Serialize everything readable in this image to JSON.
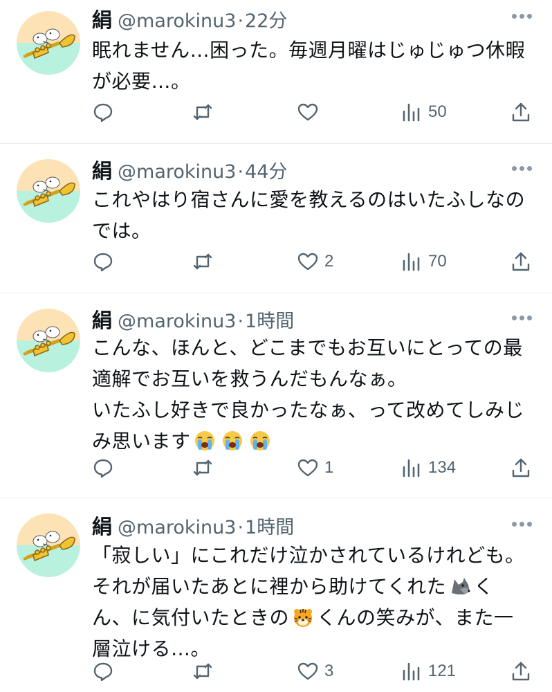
{
  "icons": {
    "reply": "reply-bubble-icon",
    "retweet": "retweet-icon",
    "like": "heart-icon",
    "views": "views-bar-icon",
    "share": "share-upload-icon",
    "more": "more-dots-icon"
  },
  "colors": {
    "text": "#0f1419",
    "muted": "#536471",
    "divider": "#e6e9ec"
  },
  "tweets": [
    {
      "name": "絹",
      "handle": "@marokinu3",
      "dot": "·",
      "time": "22分",
      "lines": [
        "眠れません…困った。毎週月曜はじゅじゅつ休暇",
        "が必要…。"
      ],
      "likes": "",
      "views": "50"
    },
    {
      "name": "絹",
      "handle": "@marokinu3",
      "dot": "·",
      "time": "44分",
      "lines": [
        "これやはり宿さんに愛を教えるのはいたふしなの",
        "では。"
      ],
      "likes": "2",
      "views": "70"
    },
    {
      "name": "絹",
      "handle": "@marokinu3",
      "dot": "·",
      "time": "1時間",
      "lines": [
        "こんな、ほんと、どこまでもお互いにとっての最",
        "適解でお互いを救うんだもんなぁ。",
        "いたふし好きで良かったなぁ、って改めてしみじ",
        "み思います"
      ],
      "emoji_crying": "😭😭😭",
      "likes": "1",
      "views": "134"
    },
    {
      "name": "絹",
      "handle": "@marokinu3",
      "dot": "·",
      "time": "1時間",
      "lines": [
        "「寂しい」にこれだけ泣かされているけれども。",
        "それが届いたあとに裡から助けてくれた",
        "ん、に気付いたときの",
        "層泣ける…。"
      ],
      "line2_suffix": "く",
      "line3_suffix": "くんの笑みが、また一",
      "emoji_wolf": "🐺",
      "emoji_tiger": "🐯",
      "likes": "3",
      "views": "121"
    }
  ]
}
